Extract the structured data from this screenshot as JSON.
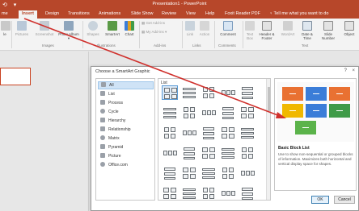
{
  "window": {
    "quick_access": "⟲ ▾",
    "title": "Presentation1 - PowerPoint"
  },
  "tabs": [
    {
      "label": "me"
    },
    {
      "label": "Insert",
      "active": true
    },
    {
      "label": "Design"
    },
    {
      "label": "Transitions"
    },
    {
      "label": "Animations"
    },
    {
      "label": "Slide Show"
    },
    {
      "label": "Review"
    },
    {
      "label": "View"
    },
    {
      "label": "Help"
    },
    {
      "label": "Foxit Reader PDF"
    },
    {
      "label": "♀ Tell me what you want to do"
    }
  ],
  "ribbon": {
    "buttons": [
      {
        "label": "le",
        "icon": "slide-icon",
        "dim": false
      },
      {
        "label": "Pictures",
        "icon": "pictures-icon",
        "dim": true
      },
      {
        "label": "Screenshot",
        "icon": "screenshot-icon",
        "dim": true
      },
      {
        "label": "Photo Album ▾",
        "icon": "photo-album-icon",
        "dim": false
      },
      {
        "label": "Shapes",
        "icon": "shapes-icon",
        "dim": true
      },
      {
        "label": "SmartArt",
        "icon": "smartart-icon",
        "dim": false
      },
      {
        "label": "Chart",
        "icon": "chart-icon",
        "dim": false
      },
      {
        "label": "Get Add-ins",
        "icon": "get-addins-icon",
        "dim": true
      },
      {
        "label": "My Add-ins ▾",
        "icon": "my-addins-icon",
        "dim": true
      },
      {
        "label": "Link",
        "icon": "link-icon",
        "dim": true
      },
      {
        "label": "Action",
        "icon": "action-icon",
        "dim": true
      },
      {
        "label": "Comment",
        "icon": "comment-icon",
        "dim": false
      },
      {
        "label": "Text Box",
        "icon": "textbox-icon",
        "dim": true
      },
      {
        "label": "Header & Footer",
        "icon": "header-footer-icon",
        "dim": false
      },
      {
        "label": "WordArt",
        "icon": "wordart-icon",
        "dim": true
      },
      {
        "label": "Date & Time",
        "icon": "date-time-icon",
        "dim": false
      },
      {
        "label": "Slide Number",
        "icon": "slide-number-icon",
        "dim": false
      },
      {
        "label": "Object",
        "icon": "object-icon",
        "dim": false
      }
    ],
    "groups": [
      "Images",
      "Illustrations",
      "Add-ins",
      "Links",
      "Comments",
      "Text"
    ]
  },
  "dialog": {
    "title": "Choose a SmartArt Graphic",
    "help": "?",
    "close": "×",
    "categories": [
      {
        "label": "All",
        "icon": "all-icon",
        "selected": true
      },
      {
        "label": "List",
        "icon": "list-icon"
      },
      {
        "label": "Process",
        "icon": "process-icon"
      },
      {
        "label": "Cycle",
        "icon": "cycle-icon"
      },
      {
        "label": "Hierarchy",
        "icon": "hierarchy-icon"
      },
      {
        "label": "Relationship",
        "icon": "relationship-icon"
      },
      {
        "label": "Matrix",
        "icon": "matrix-icon"
      },
      {
        "label": "Pyramid",
        "icon": "pyramid-icon"
      },
      {
        "label": "Picture",
        "icon": "picture-icon"
      },
      {
        "label": "Office.com",
        "icon": "office-com-icon"
      }
    ],
    "gallery_label": "List",
    "preview": {
      "name": "Basic Block List",
      "description": "Use to show non-sequential or grouped blocks of information. Maximizes both horizontal and vertical display space for shapes.",
      "colors": [
        "#e97132",
        "#3b7dd8",
        "#f0b800",
        "#3f9b48",
        "#5bb34a"
      ]
    },
    "ok_label": "OK",
    "cancel_label": "Cancel"
  },
  "annotation": {
    "color": "#d0312d"
  }
}
